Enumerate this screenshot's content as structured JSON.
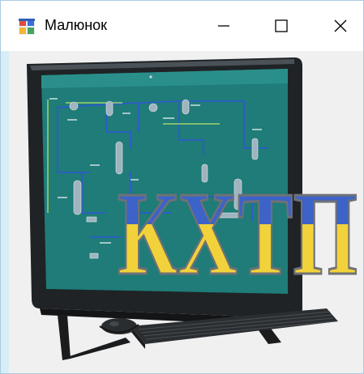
{
  "window": {
    "title": "Малюнок",
    "icon": "form-icon",
    "controls": [
      "minimize-icon",
      "maximize-icon",
      "close-icon"
    ]
  },
  "picture": {
    "logo_text": "КХТП",
    "logo_colors": {
      "top": "#3d63c8",
      "bottom": "#f2d23a"
    }
  }
}
